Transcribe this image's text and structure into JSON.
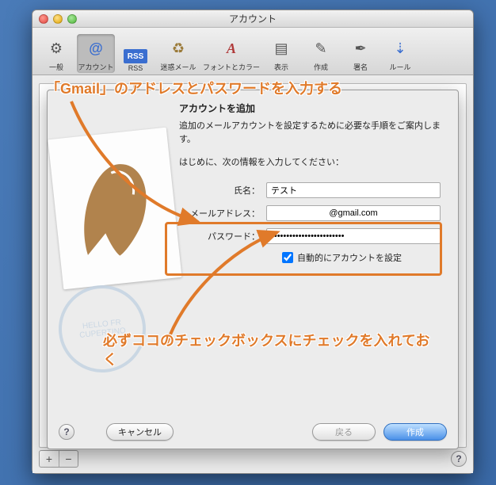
{
  "window": {
    "title": "アカウント"
  },
  "toolbar": {
    "items": [
      {
        "label": "一般",
        "glyph": "⚙"
      },
      {
        "label": "アカウント",
        "glyph": "@",
        "selected": true
      },
      {
        "label": "RSS",
        "glyph": "RSS"
      },
      {
        "label": "迷惑メール",
        "glyph": "♻"
      },
      {
        "label": "フォントとカラー",
        "glyph": "A"
      },
      {
        "label": "表示",
        "glyph": "▤"
      },
      {
        "label": "作成",
        "glyph": "✎"
      },
      {
        "label": "署名",
        "glyph": "✒"
      },
      {
        "label": "ルール",
        "glyph": "⇣"
      }
    ]
  },
  "bottom": {
    "plus": "+",
    "minus": "−",
    "help": "?"
  },
  "sheet": {
    "title": "アカウントを追加",
    "desc": "追加のメールアカウントを設定するために必要な手順をご案内します。",
    "sub": "はじめに、次の情報を入力してください：",
    "fields": {
      "name_label": "氏名：",
      "name_value": "テスト",
      "email_label": "メールアドレス：",
      "email_value": "@gmail.com",
      "password_label": "パスワード：",
      "password_value": "••••••••••••••••••••••••"
    },
    "auto_checkbox": {
      "label": "自動的にアカウントを設定",
      "checked": true
    },
    "buttons": {
      "help": "?",
      "cancel": "キャンセル",
      "back": "戻る",
      "create": "作成"
    }
  },
  "annotations": {
    "top": "「Gmail」のアドレスとパスワードを入力する",
    "bottom": "必ずココのチェックボックスにチェックを入れておく"
  }
}
